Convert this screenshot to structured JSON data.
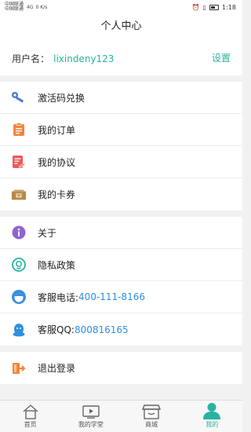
{
  "status_bar": {
    "carrier1": "中国联通",
    "carrier2": "中国联通",
    "net": "4G",
    "speed": "0 K/s",
    "time": "1:18"
  },
  "header": {
    "title": "个人中心"
  },
  "user": {
    "label": "用户名：",
    "name": "lixindeny123",
    "settings": "设置"
  },
  "menu_group1": [
    {
      "label": "激活码兑换",
      "icon": "key-icon"
    },
    {
      "label": "我的订单",
      "icon": "order-icon"
    },
    {
      "label": "我的协议",
      "icon": "agreement-icon"
    },
    {
      "label": "我的卡券",
      "icon": "coupon-icon"
    }
  ],
  "menu_group2": [
    {
      "label": "关于",
      "icon": "info-icon"
    },
    {
      "label": "隐私政策",
      "icon": "privacy-icon"
    },
    {
      "label": "客服电话:",
      "value": "400-111-8166",
      "icon": "customer-service-icon"
    },
    {
      "label": "客服QQ:",
      "value": "800816165",
      "icon": "qq-icon"
    }
  ],
  "menu_group3": [
    {
      "label": "退出登录",
      "icon": "logout-icon"
    }
  ],
  "tabbar": {
    "tabs": [
      {
        "label": "首页",
        "icon": "home-icon"
      },
      {
        "label": "我的学堂",
        "icon": "video-icon"
      },
      {
        "label": "商城",
        "icon": "shop-icon"
      },
      {
        "label": "我的",
        "icon": "person-icon",
        "active": true
      }
    ]
  },
  "colors": {
    "accent": "#27b39e",
    "link_blue": "#2f8fe0",
    "background": "#f1f1f1"
  }
}
